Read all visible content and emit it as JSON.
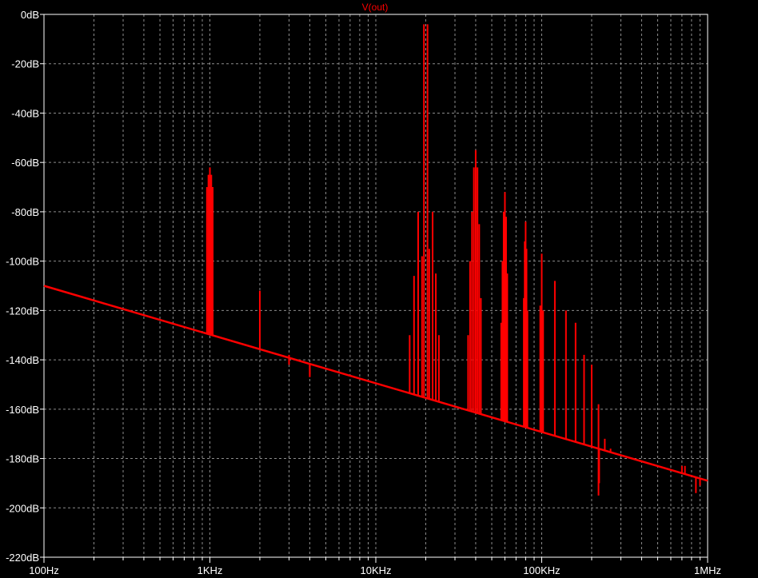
{
  "chart_data": {
    "type": "line",
    "title": "V(out)",
    "xscale": "log",
    "xlim": [
      100,
      1000000
    ],
    "ylim": [
      -220,
      0
    ],
    "grid": true,
    "series_color": "#ff0000",
    "background": "#000000",
    "axis_color": "#ffffff",
    "grid_color": "#8c8c8c",
    "y_ticks": [
      {
        "value": 0,
        "label": "0dB"
      },
      {
        "value": -20,
        "label": "-20dB"
      },
      {
        "value": -40,
        "label": "-40dB"
      },
      {
        "value": -60,
        "label": "-60dB"
      },
      {
        "value": -80,
        "label": "-80dB"
      },
      {
        "value": -100,
        "label": "-100dB"
      },
      {
        "value": -120,
        "label": "-120dB"
      },
      {
        "value": -140,
        "label": "-140dB"
      },
      {
        "value": -160,
        "label": "-160dB"
      },
      {
        "value": -180,
        "label": "-180dB"
      },
      {
        "value": -200,
        "label": "-200dB"
      },
      {
        "value": -220,
        "label": "-220dB"
      }
    ],
    "x_ticks": [
      {
        "value": 100,
        "label": "100Hz"
      },
      {
        "value": 1000,
        "label": "1KHz"
      },
      {
        "value": 10000,
        "label": "10KHz"
      },
      {
        "value": 100000,
        "label": "100KHz"
      },
      {
        "value": 1000000,
        "label": "1MHz"
      }
    ],
    "baseline": {
      "x": [
        100,
        1000000
      ],
      "y": [
        -110,
        -189
      ]
    },
    "spikes": [
      {
        "f": 960,
        "db": -70
      },
      {
        "f": 980,
        "db": -65
      },
      {
        "f": 1000,
        "db": -62
      },
      {
        "f": 1020,
        "db": -65
      },
      {
        "f": 1040,
        "db": -70
      },
      {
        "f": 2000,
        "db": -112
      },
      {
        "f": 3000,
        "db": -138
      },
      {
        "f": 4000,
        "db": -146
      },
      {
        "f": 16000,
        "db": -130
      },
      {
        "f": 17000,
        "db": -106
      },
      {
        "f": 18000,
        "db": -80
      },
      {
        "f": 19000,
        "db": -98
      },
      {
        "f": 19500,
        "db": -4
      },
      {
        "f": 20500,
        "db": -4
      },
      {
        "f": 21000,
        "db": -95
      },
      {
        "f": 22000,
        "db": -80
      },
      {
        "f": 23000,
        "db": -105
      },
      {
        "f": 24000,
        "db": -130
      },
      {
        "f": 36000,
        "db": -130
      },
      {
        "f": 37000,
        "db": -100
      },
      {
        "f": 38000,
        "db": -80
      },
      {
        "f": 39000,
        "db": -62
      },
      {
        "f": 40000,
        "db": -55
      },
      {
        "f": 41000,
        "db": -62
      },
      {
        "f": 42000,
        "db": -85
      },
      {
        "f": 43000,
        "db": -115
      },
      {
        "f": 57000,
        "db": -125
      },
      {
        "f": 58000,
        "db": -100
      },
      {
        "f": 59000,
        "db": -80
      },
      {
        "f": 60000,
        "db": -72
      },
      {
        "f": 61000,
        "db": -82
      },
      {
        "f": 62000,
        "db": -105
      },
      {
        "f": 78000,
        "db": -115
      },
      {
        "f": 79000,
        "db": -92
      },
      {
        "f": 80000,
        "db": -84
      },
      {
        "f": 81000,
        "db": -95
      },
      {
        "f": 82000,
        "db": -120
      },
      {
        "f": 98000,
        "db": -118
      },
      {
        "f": 100000,
        "db": -97
      },
      {
        "f": 102000,
        "db": -120
      },
      {
        "f": 120000,
        "db": -108
      },
      {
        "f": 140000,
        "db": -120
      },
      {
        "f": 160000,
        "db": -125
      },
      {
        "f": 180000,
        "db": -138
      },
      {
        "f": 200000,
        "db": -142
      },
      {
        "f": 220000,
        "db": -158
      },
      {
        "f": 240000,
        "db": -172
      },
      {
        "f": 260000,
        "db": -176
      },
      {
        "f": 280000,
        "db": -178
      },
      {
        "f": 700000,
        "db": -183
      },
      {
        "f": 730000,
        "db": -183
      }
    ],
    "dips": [
      {
        "f": 3000,
        "db": -142
      },
      {
        "f": 4000,
        "db": -147
      },
      {
        "f": 220000,
        "db": -195
      },
      {
        "f": 222000,
        "db": -190
      },
      {
        "f": 850000,
        "db": -194
      },
      {
        "f": 900000,
        "db": -191
      }
    ]
  }
}
